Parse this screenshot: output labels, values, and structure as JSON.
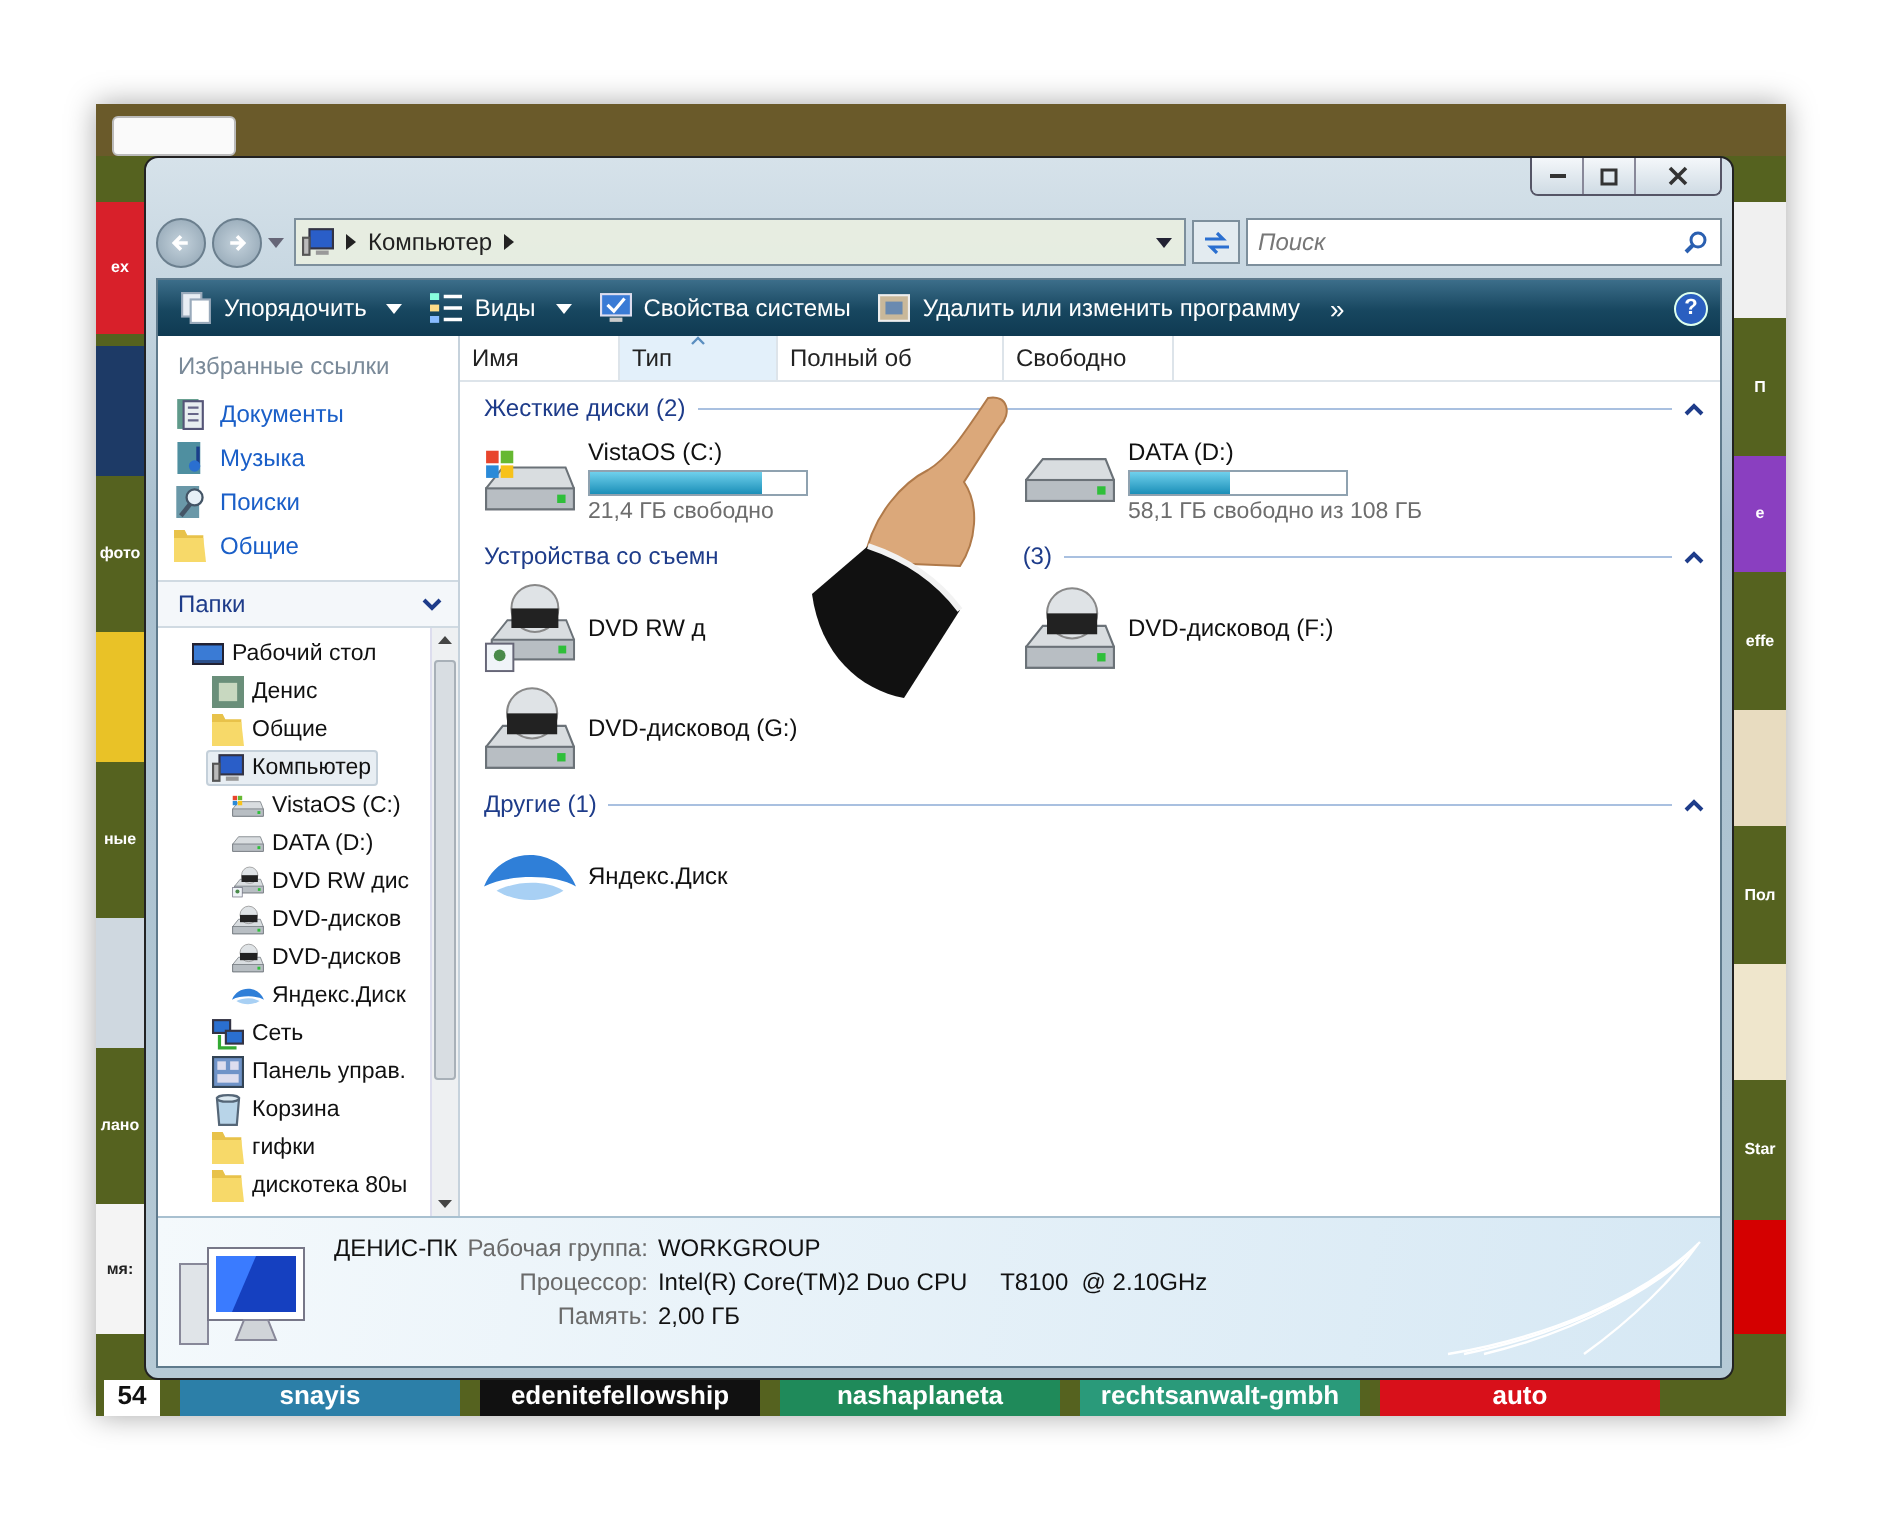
{
  "background": {
    "left_tiles": [
      {
        "text": "ex",
        "color": "#d8202a"
      },
      {
        "color": "#1d3a66"
      },
      {
        "text": "фото",
        "color": "#55621f"
      },
      {
        "color": "#e9c227"
      },
      {
        "text": "ные",
        "color": "#55621f"
      },
      {
        "color": "#cfd8e0"
      },
      {
        "text": "лано",
        "color": "#55621f"
      },
      {
        "text": "мя:",
        "color": "#f4f4f4"
      }
    ],
    "right_tiles": [
      {
        "color": "#f0f0f0"
      },
      {
        "text": "П",
        "color": "#55621f"
      },
      {
        "text": "e",
        "color": "#8a3fc0"
      },
      {
        "text": "effe",
        "color": "#55621f"
      },
      {
        "color": "#e8dcc0"
      },
      {
        "text": "Пол",
        "color": "#55621f"
      },
      {
        "color": "#efe6cc"
      },
      {
        "text": "Star",
        "color": "#55621f"
      },
      {
        "color": "#d40000"
      }
    ],
    "bottom_tiles": [
      {
        "text": "54",
        "color": "#ffffff"
      },
      {
        "text": "snayis",
        "color": "#2c7fa8"
      },
      {
        "text": "edenitefellowship",
        "color": "#111111"
      },
      {
        "text": "nashaplaneta",
        "color": "#1f8a5a"
      },
      {
        "text": "rechtsanwalt-gmbh",
        "color": "#2a9a7a"
      },
      {
        "text": "auto",
        "color": "#d8101a"
      }
    ]
  },
  "address": {
    "path": "Компьютер"
  },
  "search": {
    "placeholder": "Поиск"
  },
  "toolbar": [
    {
      "label": "Упорядочить",
      "kind": "organize",
      "dropdown": true
    },
    {
      "label": "Виды",
      "kind": "views",
      "dropdown": true
    },
    {
      "label": "Свойства системы",
      "kind": "system",
      "dropdown": false
    },
    {
      "label": "Удалить или изменить программу",
      "kind": "programs",
      "dropdown": false
    }
  ],
  "toolbar_more": "»",
  "help": "?",
  "sidebar": {
    "favorites_title": "Избранные ссылки",
    "favorites": [
      {
        "label": "Документы",
        "kind": "documents"
      },
      {
        "label": "Музыка",
        "kind": "music"
      },
      {
        "label": "Поиски",
        "kind": "searches"
      },
      {
        "label": "Общие",
        "kind": "folder"
      }
    ],
    "folders_title": "Папки",
    "tree": [
      {
        "label": "Рабочий стол",
        "kind": "desktop",
        "selected": false,
        "children": [
          {
            "label": "Денис",
            "kind": "user",
            "selected": false
          },
          {
            "label": "Общие",
            "kind": "folder",
            "selected": false
          },
          {
            "label": "Компьютер",
            "kind": "computer",
            "selected": true,
            "children": [
              {
                "label": "VistaOS (C:)",
                "kind": "hdd-system",
                "selected": false
              },
              {
                "label": "DATA (D:)",
                "kind": "hdd",
                "selected": false
              },
              {
                "label": "DVD RW дис",
                "kind": "dvd-shared",
                "selected": false
              },
              {
                "label": "DVD-дисков",
                "kind": "dvd",
                "selected": false
              },
              {
                "label": "DVD-дисков",
                "kind": "dvd",
                "selected": false
              },
              {
                "label": "Яндекс.Диск",
                "kind": "cloud",
                "selected": false
              }
            ]
          },
          {
            "label": "Сеть",
            "kind": "network",
            "selected": false
          },
          {
            "label": "Панель управ.",
            "kind": "control-panel",
            "selected": false
          },
          {
            "label": "Корзина",
            "kind": "recycle",
            "selected": false
          },
          {
            "label": "гифки",
            "kind": "folder",
            "selected": false
          },
          {
            "label": "дискотека 80ы",
            "kind": "folder",
            "selected": false
          }
        ]
      }
    ]
  },
  "columns": [
    {
      "label": "Имя",
      "sorted": false
    },
    {
      "label": "Тип",
      "sorted": true
    },
    {
      "label": "Полный об",
      "sorted": false
    },
    {
      "label": "Свободно",
      "sorted": false
    }
  ],
  "groups": [
    {
      "title": "Жесткие диски (2)",
      "items": [
        {
          "name": "VistaOS (C:)",
          "kind": "hdd-system",
          "level": 0.8,
          "info": "21,4 ГБ свободно"
        },
        {
          "name": "DATA (D:)",
          "kind": "hdd",
          "level": 0.46,
          "info": "58,1 ГБ свободно из 108 ГБ"
        }
      ]
    },
    {
      "title": "Устройства со съемн",
      "title_end": "(3)",
      "items": [
        {
          "name": "DVD RW д",
          "kind": "dvd-shared"
        },
        {
          "name": "DVD-дисковод (F:)",
          "kind": "dvd"
        },
        {
          "name": "DVD-дисковод (G:)",
          "kind": "dvd"
        }
      ]
    },
    {
      "title": "Другие (1)",
      "items": [
        {
          "name": "Яндекс.Диск",
          "kind": "cloud"
        }
      ]
    }
  ],
  "details": {
    "computer": "ДЕНИС-ПК",
    "rows": [
      {
        "label": "Рабочая группа:",
        "value": "WORKGROUP"
      },
      {
        "label": "Процессор:",
        "value": "Intel(R) Core(TM)2 Duo CPU     T8100  @ 2.10GHz"
      },
      {
        "label": "Память:",
        "value": "2,00 ГБ"
      }
    ]
  }
}
